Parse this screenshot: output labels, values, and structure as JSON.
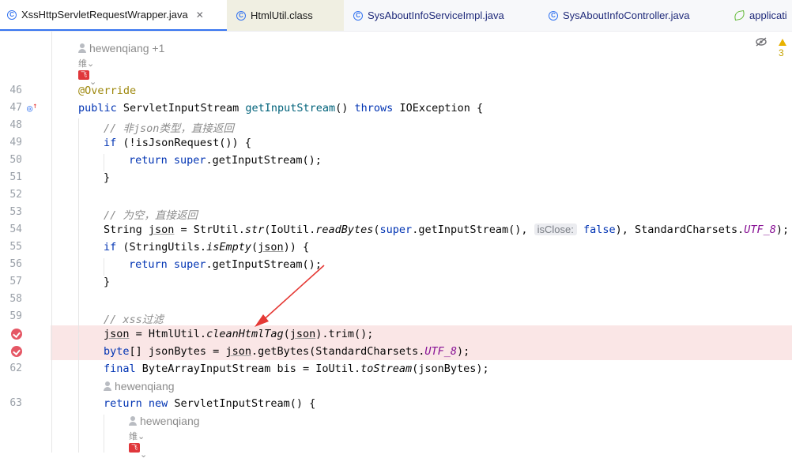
{
  "tabs": [
    {
      "label": "XssHttpServletRequestWrapper.java",
      "close": "✕"
    },
    {
      "label": "HtmlUtil.class"
    },
    {
      "label": "SysAboutInfoServiceImpl.java"
    },
    {
      "label": "SysAboutInfoController.java"
    },
    {
      "label": "applicati"
    }
  ],
  "tab_icon_letter": "C",
  "reader_indicator": "3",
  "authors": {
    "top": "hewenqiang +1",
    "mid": "hewenqiang",
    "bottom": "hewenqiang"
  },
  "plugin_glyphs": {
    "ai": "维",
    "fs": "飞书",
    "chevron": "⌄"
  },
  "line_numbers": {
    "l46": "46",
    "l47": "47",
    "l48": "48",
    "l49": "49",
    "l50": "50",
    "l51": "51",
    "l52": "52",
    "l53": "53",
    "l54": "54",
    "l55": "55",
    "l56": "56",
    "l57": "57",
    "l58": "58",
    "l59": "59",
    "l62": "62",
    "l63": "63"
  },
  "code": {
    "l46": {
      "ann": "@Override"
    },
    "l47": {
      "kw1": "public ",
      "t1": "ServletInputStream ",
      "fn": "getInputStream",
      "t2": "() ",
      "kw2": "throws ",
      "t3": "IOException {"
    },
    "l48": {
      "cm": "// 非json类型，直接返回"
    },
    "l49": {
      "kw": "if ",
      "t": "(!isJsonRequest()) {"
    },
    "l50": {
      "kw1": "return ",
      "kw2": "super",
      "t": ".getInputStream();"
    },
    "l51": {
      "t": "}"
    },
    "l53": {
      "cm": "// 为空，直接返回"
    },
    "l54": {
      "t1": "String ",
      "v": "json",
      "t2": " = StrUtil.",
      "i1": "str",
      "t3": "(IoUtil.",
      "i2": "readBytes",
      "t4": "(",
      "kw1": "super",
      "t5": ".getInputStream(), ",
      "hint": "isClose:",
      "kw2": " false",
      "t6": "), StandardCharsets.",
      "c": "UTF_8",
      "t7": ");"
    },
    "l55": {
      "kw": "if ",
      "t1": "(StringUtils.",
      "i": "isEmpty",
      "t2": "(",
      "v": "json",
      "t3": ")) {"
    },
    "l56": {
      "kw1": "return ",
      "kw2": "super",
      "t": ".getInputStream();"
    },
    "l57": {
      "t": "}"
    },
    "l59": {
      "cm": "// xss过滤"
    },
    "l60": {
      "v": "json",
      "t1": " = HtmlUtil.",
      "i": "cleanHtmlTag",
      "t2": "(",
      "v2": "json",
      "t3": ").trim();"
    },
    "l61": {
      "kw": "byte",
      "t1": "[] jsonBytes = ",
      "v": "json",
      "t2": ".getBytes(StandardCharsets.",
      "c": "UTF_8",
      "t3": ");"
    },
    "l62": {
      "kw": "final ",
      "t1": "ByteArrayInputStream bis = IoUtil.",
      "i": "toStream",
      "t2": "(jsonBytes);"
    },
    "l63": {
      "kw1": "return ",
      "kw2": "new ",
      "t": "ServletInputStream() {"
    }
  },
  "colors": {
    "keyword": "#0033b3",
    "comment": "#8c8c8c",
    "annotation": "#9e880d",
    "constant": "#871094",
    "breakpoint": "#e55765",
    "highlight": "#fae6e6",
    "arrow": "#e53935"
  }
}
